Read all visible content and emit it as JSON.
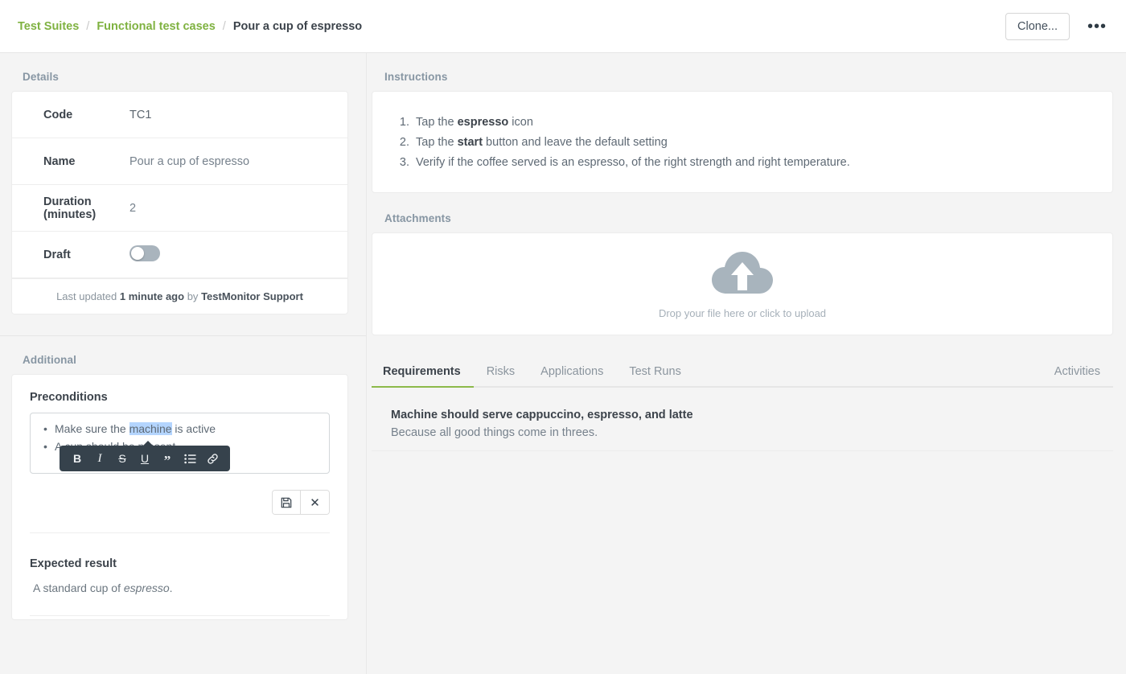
{
  "theme": {
    "accent_green": "#8cb94a",
    "link_green": "#7fb241",
    "selection_blue": "#b4d5fe",
    "toolbar_dark": "#36424c",
    "page_bg": "#f4f4f4"
  },
  "topbar": {
    "breadcrumb": [
      {
        "label": "Test Suites",
        "current": false
      },
      {
        "label": "Functional test cases",
        "current": false
      },
      {
        "label": "Pour a cup of espresso",
        "current": true
      }
    ],
    "separator": "/",
    "clone_label": "Clone...",
    "kebab_label": "•••"
  },
  "left": {
    "details_label": "Details",
    "rows": [
      {
        "label": "Code",
        "value": "TC1"
      },
      {
        "label": "Name",
        "value": "Pour a cup of espresso"
      },
      {
        "label": "Duration (minutes)",
        "value": "2"
      }
    ],
    "draft": {
      "label": "Draft",
      "state": "off"
    },
    "footer": {
      "prefix": "Last updated",
      "time": "1 minute ago",
      "by": "by",
      "user": "TestMonitor Support"
    },
    "additional_label": "Additional",
    "preconditions": {
      "title": "Preconditions",
      "items": [
        {
          "before": "Make sure the ",
          "selected": "machine",
          "after": " is active"
        },
        {
          "before": "A cup should be present",
          "selected": "",
          "after": ""
        }
      ]
    },
    "format_toolbar": [
      {
        "name": "bold",
        "glyph": "B"
      },
      {
        "name": "italic",
        "glyph": "I"
      },
      {
        "name": "strikethrough",
        "glyph": "S"
      },
      {
        "name": "underline",
        "glyph": "U"
      },
      {
        "name": "blockquote",
        "glyph": "”"
      },
      {
        "name": "bullet-list",
        "glyph": ""
      },
      {
        "name": "link",
        "glyph": ""
      }
    ],
    "editor_actions": {
      "save": "save-icon",
      "cancel": "✕"
    },
    "expected": {
      "title": "Expected result",
      "before": "A standard cup of ",
      "italic": "espresso",
      "after": "."
    }
  },
  "right": {
    "instructions_label": "Instructions",
    "instructions": [
      {
        "before": "Tap the ",
        "bold": "espresso",
        "after": " icon"
      },
      {
        "before": "Tap the ",
        "bold": "start",
        "after": " button and leave the default setting"
      },
      {
        "before": "Verify if the coffee served is an espresso, of the right strength and right temperature.",
        "bold": "",
        "after": ""
      }
    ],
    "attachments_label": "Attachments",
    "dropzone": {
      "icon": "cloud-upload-icon",
      "label": "Drop your file here or click to upload"
    },
    "tabs": [
      {
        "label": "Requirements",
        "active": true
      },
      {
        "label": "Risks",
        "active": false
      },
      {
        "label": "Applications",
        "active": false
      },
      {
        "label": "Test Runs",
        "active": false
      }
    ],
    "activities_tab": "Activities",
    "requirements": [
      {
        "title": "Machine should serve cappuccino, espresso, and latte",
        "desc": "Because all good things come in threes."
      }
    ]
  }
}
